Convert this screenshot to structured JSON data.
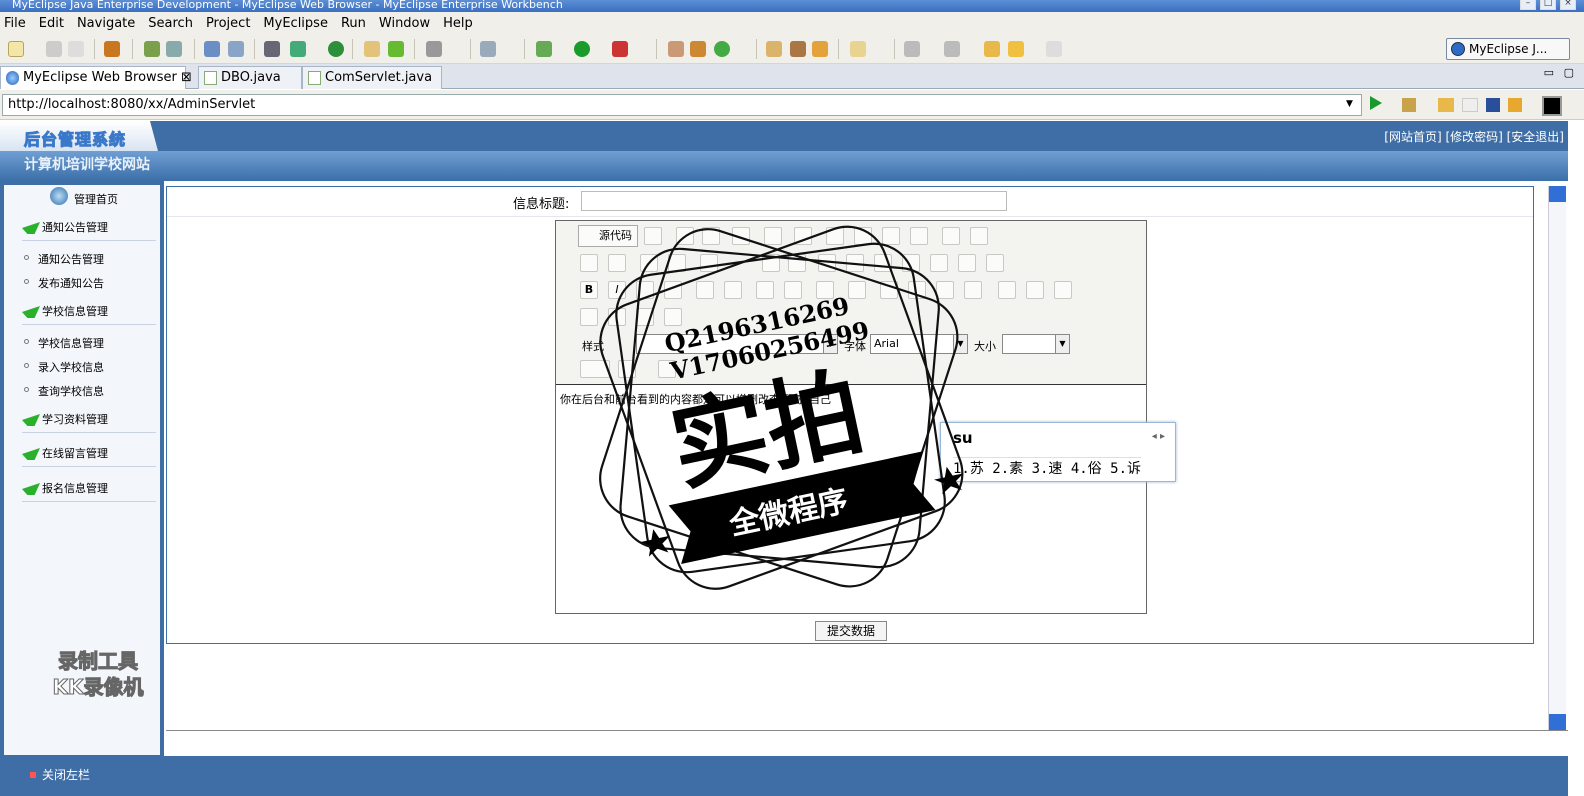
{
  "window": {
    "title": "MyEclipse Java Enterprise Development - MyEclipse Web Browser - MyEclipse Enterprise Workbench"
  },
  "menu": [
    "File",
    "Edit",
    "Navigate",
    "Search",
    "Project",
    "MyEclipse",
    "Run",
    "Window",
    "Help"
  ],
  "perspective": {
    "label": "MyEclipse J..."
  },
  "tabs": [
    {
      "label": "MyEclipse Web Browser",
      "close": "⊠"
    },
    {
      "label": "DBO.java"
    },
    {
      "label": "ComServlet.java"
    }
  ],
  "address": {
    "url": "http://localhost:8080/xx/AdminServlet"
  },
  "site": {
    "logo": "后台管理系统",
    "top_links": "[网站首页] [修改密码] [安全退出]",
    "site_name": "计算机培训学校网站"
  },
  "sidebar": {
    "home": "管理首页",
    "groups": [
      {
        "label": "通知公告管理",
        "items": [
          "通知公告管理",
          "发布通知公告"
        ]
      },
      {
        "label": "学校信息管理",
        "items": [
          "学校信息管理",
          "录入学校信息",
          "查询学校信息"
        ]
      },
      {
        "label": "学习资料管理",
        "items": []
      },
      {
        "label": "在线留言管理",
        "items": []
      },
      {
        "label": "报名信息管理",
        "items": []
      }
    ],
    "recorder_line1": "录制工具",
    "recorder_line2": "KK录像机"
  },
  "form": {
    "title_label": "信息标题:",
    "title_value": "",
    "editor": {
      "source_button": "源代码",
      "style_label": "样式",
      "font_label": "字体",
      "font_value": "Arial",
      "size_label": "大小",
      "body_text": "你在后台和前台看到的内容都是可以增删改查 程序 自己"
    },
    "submit_label": "提交数据"
  },
  "ime": {
    "input": "su",
    "candidates": "1.苏 2.素 3.速 4.俗 5.诉"
  },
  "watermark": {
    "line1": "Q2196316269",
    "line2": "V17060256499",
    "big": "实拍",
    "ribbon": "全微程序"
  },
  "footer": {
    "toggle": "关闭左栏"
  }
}
